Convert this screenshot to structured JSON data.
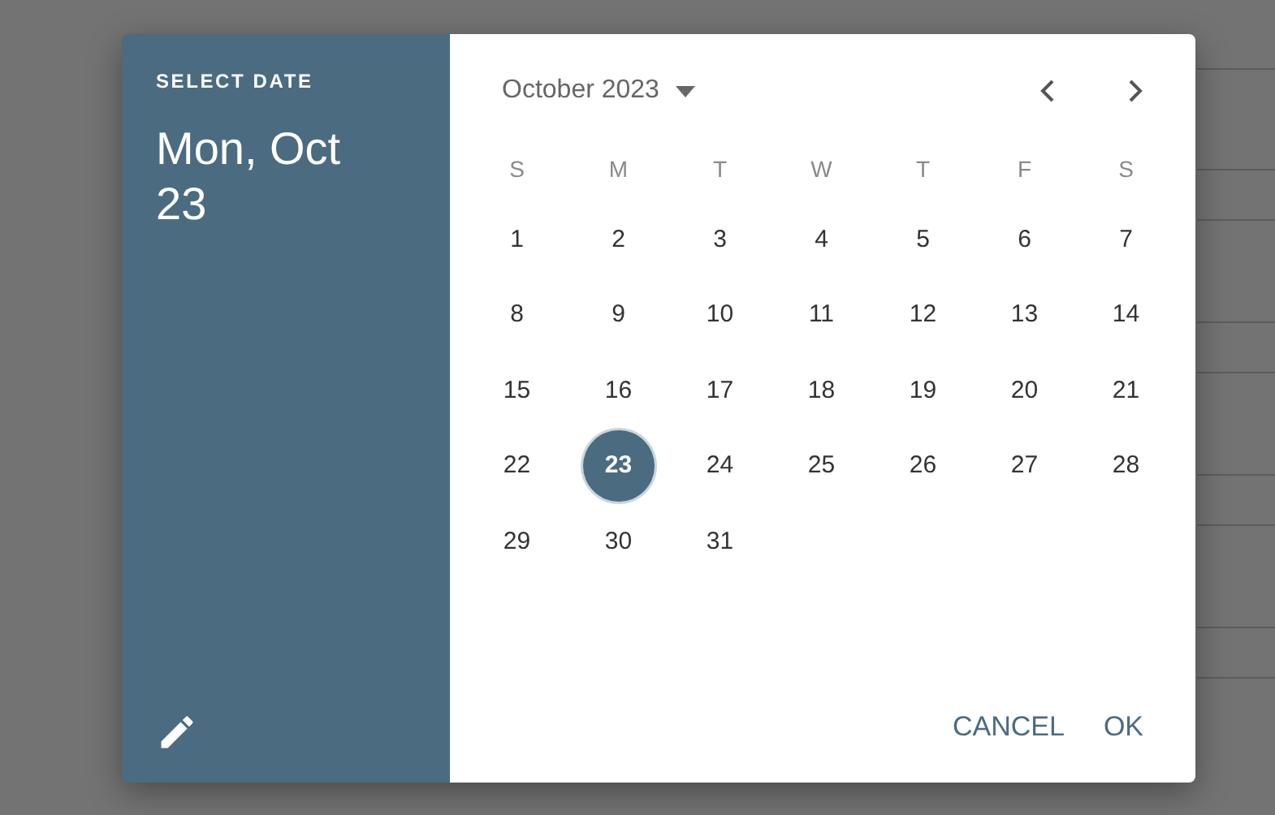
{
  "dialog": {
    "header_label": "SELECT DATE",
    "selected_date": "Mon, Oct 23",
    "month_label": "October 2023",
    "weekdays": [
      "S",
      "M",
      "T",
      "W",
      "T",
      "F",
      "S"
    ],
    "weeks": [
      [
        {
          "day": "1",
          "selected": false
        },
        {
          "day": "2",
          "selected": false
        },
        {
          "day": "3",
          "selected": false
        },
        {
          "day": "4",
          "selected": false
        },
        {
          "day": "5",
          "selected": false
        },
        {
          "day": "6",
          "selected": false
        },
        {
          "day": "7",
          "selected": false
        }
      ],
      [
        {
          "day": "8",
          "selected": false
        },
        {
          "day": "9",
          "selected": false
        },
        {
          "day": "10",
          "selected": false
        },
        {
          "day": "11",
          "selected": false
        },
        {
          "day": "12",
          "selected": false
        },
        {
          "day": "13",
          "selected": false
        },
        {
          "day": "14",
          "selected": false
        }
      ],
      [
        {
          "day": "15",
          "selected": false
        },
        {
          "day": "16",
          "selected": false
        },
        {
          "day": "17",
          "selected": false
        },
        {
          "day": "18",
          "selected": false
        },
        {
          "day": "19",
          "selected": false
        },
        {
          "day": "20",
          "selected": false
        },
        {
          "day": "21",
          "selected": false
        }
      ],
      [
        {
          "day": "22",
          "selected": false
        },
        {
          "day": "23",
          "selected": true
        },
        {
          "day": "24",
          "selected": false
        },
        {
          "day": "25",
          "selected": false
        },
        {
          "day": "26",
          "selected": false
        },
        {
          "day": "27",
          "selected": false
        },
        {
          "day": "28",
          "selected": false
        }
      ],
      [
        {
          "day": "29",
          "selected": false
        },
        {
          "day": "30",
          "selected": false
        },
        {
          "day": "31",
          "selected": false
        }
      ]
    ],
    "buttons": [
      "CANCEL",
      "OK"
    ]
  }
}
